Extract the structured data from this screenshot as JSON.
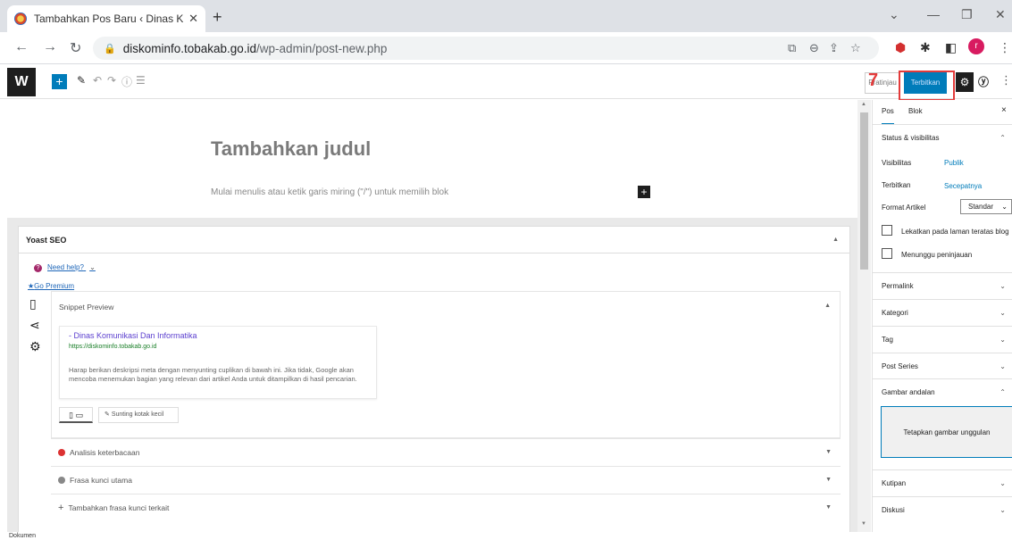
{
  "browser": {
    "tab_title": "Tambahkan Pos Baru ‹ Dinas Kom",
    "tab_close": "✕",
    "new_tab": "+",
    "url_host": "diskominfo.tobakab.go.id",
    "url_path": "/wp-admin/post-new.php",
    "profile_initial": "r"
  },
  "toolbar": {
    "preview_label": "Pratinjau",
    "publish_label": "Terbitkan",
    "step_number": "7"
  },
  "editor": {
    "title_placeholder": "Tambahkan judul",
    "body_placeholder": "Mulai menulis atau ketik garis miring (\"/\") untuk memilih blok"
  },
  "yoast": {
    "header": "Yoast SEO",
    "need_help": "Need help?",
    "go_premium": "Go Premium",
    "snippet_preview": "Snippet Preview",
    "serp_title": "- Dinas Komunikasi Dan Informatika",
    "serp_url": "https://diskominfo.tobakab.go.id",
    "serp_description": "Harap berikan deskripsi meta dengan menyunting cuplikan di bawah ini. Jika tidak, Google akan mencoba menemukan bagian yang relevan dari artikel Anda untuk ditampilkan di hasil pencarian.",
    "edit_snippet": "Sunting kotak kecil",
    "rows": [
      {
        "label": "Analisis keterbacaan",
        "color": "#dc3232"
      },
      {
        "label": "Frasa kunci utama",
        "color": "#888888"
      },
      {
        "label": "Tambahkan frasa kunci terkait",
        "prefix": "+"
      }
    ]
  },
  "sidebar": {
    "tab_post": "Pos",
    "tab_block": "Blok",
    "close": "×",
    "status_section": "Status & visibilitas",
    "visibility_label": "Visibilitas",
    "visibility_value": "Publik",
    "publish_label": "Terbitkan",
    "publish_value": "Secepatnya",
    "format_label": "Format Artikel",
    "format_value": "Standar",
    "sticky_label": "Lekatkan pada laman teratas blog",
    "pending_label": "Menunggu peninjauan",
    "sections": [
      "Permalink",
      "Kategori",
      "Tag",
      "Post Series"
    ],
    "featured_section": "Gambar andalan",
    "featured_button": "Tetapkan gambar unggulan",
    "bottom_sections": [
      "Kutipan",
      "Diskusi"
    ]
  },
  "status_bar": {
    "breadcrumb": "Dokumen"
  },
  "colors": {
    "wp_blue": "#007cba",
    "highlight_red": "#e33b3b"
  }
}
